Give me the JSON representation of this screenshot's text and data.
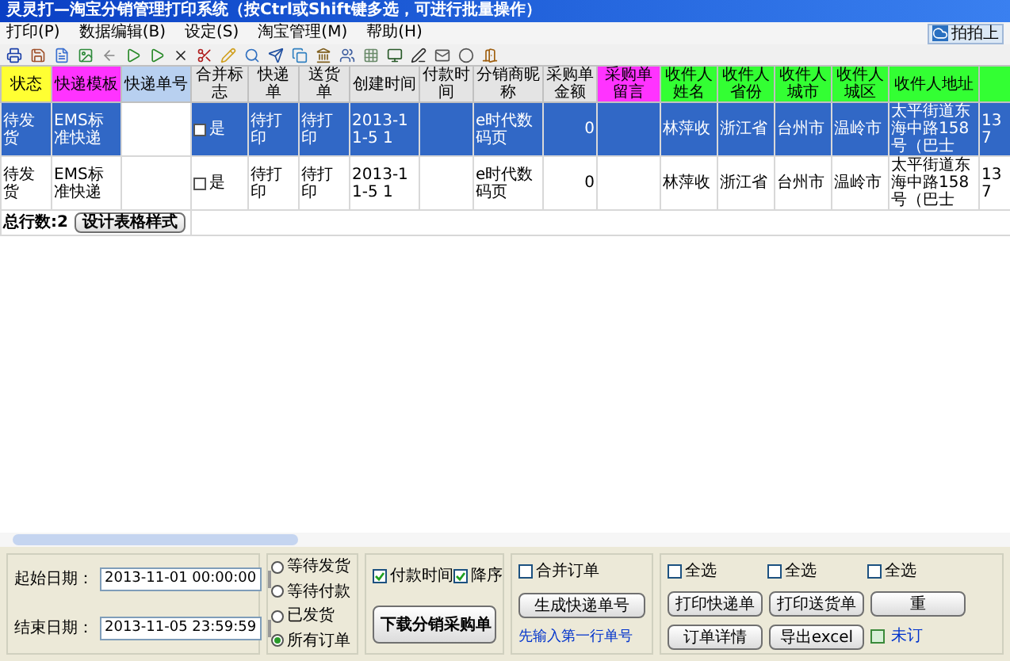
{
  "window": {
    "title": "灵灵打—淘宝分销管理打印系统（按Ctrl或Shift键多选，可进行批量操作）"
  },
  "menu": [
    "打印(P)",
    "数据编辑(B)",
    "设定(S)",
    "淘宝管理(M)",
    "帮助(H)"
  ],
  "top_right_button": "拍拍上",
  "table": {
    "columns": [
      {
        "label": "状态",
        "color": "#ffff33"
      },
      {
        "label": "快递模板",
        "color": "#ff33ff"
      },
      {
        "label": "快递单号",
        "color": "#b8d0f0"
      },
      {
        "label": "合并标志",
        "color": "#e4e4e4"
      },
      {
        "label": "快递单",
        "color": "#e4e4e4"
      },
      {
        "label": "送货单",
        "color": "#e4e4e4"
      },
      {
        "label": "创建时间",
        "color": "#e4e4e4"
      },
      {
        "label": "付款时间",
        "color": "#e4e4e4"
      },
      {
        "label": "分销商昵称",
        "color": "#e4e4e4"
      },
      {
        "label": "采购单金额",
        "color": "#e4e4e4"
      },
      {
        "label": "采购单留言",
        "color": "#ff33ff"
      },
      {
        "label": "收件人姓名",
        "color": "#33ff33"
      },
      {
        "label": "收件人省份",
        "color": "#33ff33"
      },
      {
        "label": "收件人城市",
        "color": "#33ff33"
      },
      {
        "label": "收件人城区",
        "color": "#33ff33"
      },
      {
        "label": "收件人地址",
        "color": "#33ff33"
      },
      {
        "color": "#33ff33"
      }
    ],
    "rows": [
      {
        "selected": true,
        "merge_checked": false,
        "cells": [
          "待发货",
          "EMS标准快递",
          "",
          "是",
          "待打印",
          "待打印",
          "2013-11-5 1",
          "",
          "e时代数码页",
          "0",
          "",
          "林萍收",
          "浙江省",
          "台州市",
          "温岭市",
          "太平街道东海中路158号（巴士",
          "137"
        ]
      },
      {
        "selected": false,
        "merge_checked": false,
        "cells": [
          "待发货",
          "EMS标准快递",
          "",
          "是",
          "待打印",
          "待打印",
          "2013-11-5 1",
          "",
          "e时代数码页",
          "0",
          "",
          "林萍收",
          "浙江省",
          "台州市",
          "温岭市",
          "太平街道东海中路158号（巴士",
          "137"
        ]
      }
    ],
    "row_count": "总行数:2",
    "design_button": "设计表格样式"
  },
  "dates": [
    {
      "label": "起始日期：",
      "value": "2013-11-01 00:00:00"
    },
    {
      "label": "结束日期：",
      "value": "2013-11-05 23:59:59"
    }
  ],
  "order_filters": [
    {
      "label": "等待发货",
      "selected": false
    },
    {
      "label": "等待付款",
      "selected": false
    },
    {
      "label": "已发货",
      "selected": false
    },
    {
      "label": "所有订单",
      "selected": true
    }
  ],
  "sort": [
    {
      "label": "付款时间",
      "checked": true
    },
    {
      "label": "降序",
      "checked": true
    }
  ],
  "download_button": "下载分销采购单",
  "merge": {
    "label": "合并订单",
    "checked": false
  },
  "generate_button": "生成快递单号",
  "generate_hint": "先输入第一行单号",
  "select_all": [
    {
      "label": "全选",
      "checked": false
    },
    {
      "label": "全选",
      "checked": false
    },
    {
      "label": "全选",
      "checked": false
    }
  ],
  "print_buttons": [
    "打印快递单",
    "打印送货单",
    "重"
  ],
  "print_buttons_2": [
    "订单详情",
    "导出excel"
  ],
  "unprinted_link": "未订"
}
